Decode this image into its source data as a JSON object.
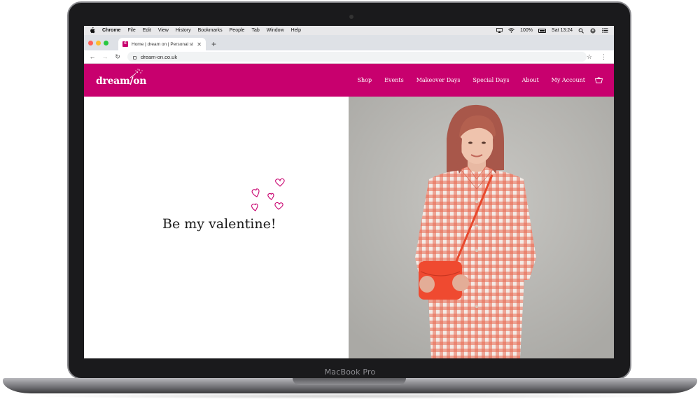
{
  "device": {
    "label": "MacBook Pro"
  },
  "menubar": {
    "app": "Chrome",
    "items": [
      "File",
      "Edit",
      "View",
      "History",
      "Bookmarks",
      "People",
      "Tab",
      "Window",
      "Help"
    ],
    "battery": "100%",
    "clock": "Sat 13:24"
  },
  "browser": {
    "tab_title": "Home | dream on | Personal st",
    "url": "dream-on.co.uk"
  },
  "site": {
    "logo": "dream/on",
    "nav": [
      "Shop",
      "Events",
      "Makeover Days",
      "Special Days",
      "About",
      "My Account"
    ],
    "brand_color": "#c8006e",
    "hero_title": "Be my valentine!"
  }
}
